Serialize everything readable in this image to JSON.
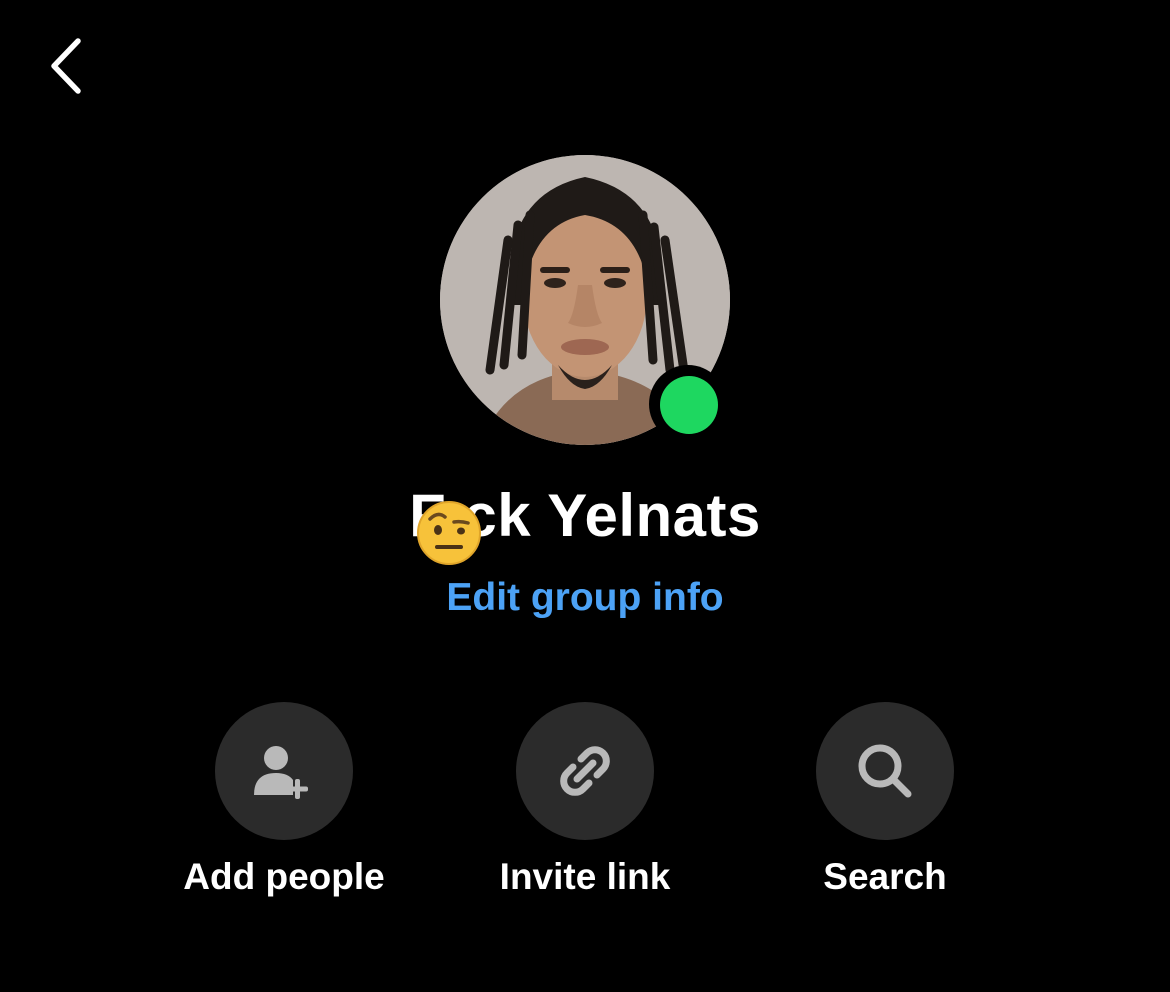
{
  "header": {
    "back_icon": "chevron-left-icon"
  },
  "profile": {
    "avatar_description": "group-avatar-photo",
    "online_status": "online",
    "status_color": "#1ed760",
    "group_name": "F  ck Yelnats",
    "name_emoji_icon": "face-with-raised-eyebrow-icon",
    "edit_link_label": "Edit group info",
    "edit_link_color": "#4ca2f6"
  },
  "actions": [
    {
      "label": "Add people",
      "icon": "add-person-icon"
    },
    {
      "label": "Invite link",
      "icon": "link-icon"
    },
    {
      "label": "Search",
      "icon": "search-icon"
    }
  ],
  "colors": {
    "background": "#000000",
    "action_circle": "#2b2b2b",
    "icon_gray": "#b9b9b9"
  }
}
